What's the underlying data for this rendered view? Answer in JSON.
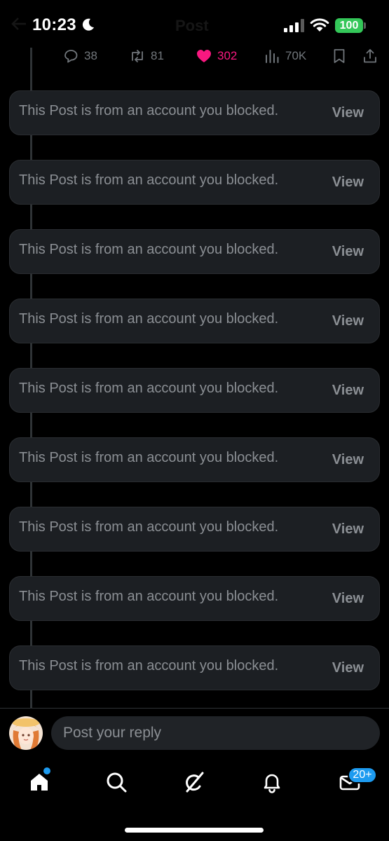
{
  "status_bar": {
    "time": "10:23",
    "battery": "100",
    "faint_title": "Post"
  },
  "actions": {
    "replies": "38",
    "reposts": "81",
    "likes": "302",
    "views": "70K"
  },
  "blocked_posts": [
    {
      "text": "This Post is from an account you blocked.",
      "view_label": "View"
    },
    {
      "text": "This Post is from an account you blocked.",
      "view_label": "View"
    },
    {
      "text": "This Post is from an account you blocked.",
      "view_label": "View"
    },
    {
      "text": "This Post is from an account you blocked.",
      "view_label": "View"
    },
    {
      "text": "This Post is from an account you blocked.",
      "view_label": "View"
    },
    {
      "text": "This Post is from an account you blocked.",
      "view_label": "View"
    },
    {
      "text": "This Post is from an account you blocked.",
      "view_label": "View"
    },
    {
      "text": "This Post is from an account you blocked.",
      "view_label": "View"
    },
    {
      "text": "This Post is from an account you blocked.",
      "view_label": "View"
    }
  ],
  "reply": {
    "placeholder": "Post your reply"
  },
  "tab_bar": {
    "tabs": [
      "home-icon",
      "search-icon",
      "grok-icon",
      "bell-icon",
      "mail-icon"
    ],
    "messages_badge": "20+"
  },
  "colors": {
    "background": "#000000",
    "card": "#1c1f23",
    "like": "#f91880",
    "accent": "#1d9bf0",
    "battery": "#34c759"
  }
}
